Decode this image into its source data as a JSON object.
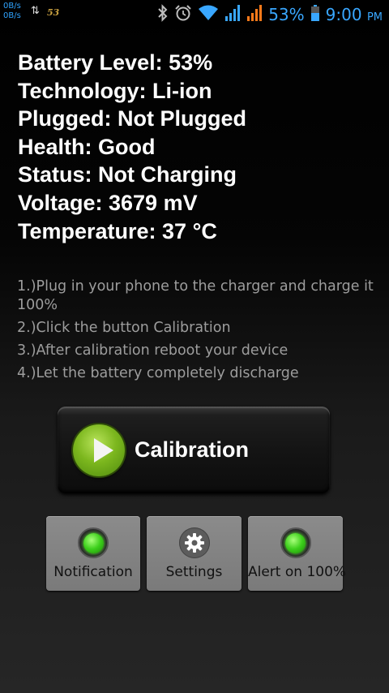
{
  "status_bar": {
    "net_up": "0B/s",
    "net_down": "0B/s",
    "notification_count": "53",
    "battery_percent": "53%",
    "time": "9:00",
    "ampm": "PM",
    "icons": [
      "bluetooth-icon",
      "alarm-icon",
      "wifi-icon",
      "signal-icon",
      "signal-2-icon",
      "battery-icon"
    ],
    "accent_color": "#39a7ff"
  },
  "battery_info": [
    "Battery Level: 53%",
    "Technology: Li-ion",
    "Plugged: Not Plugged",
    "Health: Good",
    "Status: Not Charging",
    "Voltage: 3679 mV",
    "Temperature: 37 °C"
  ],
  "instructions": [
    "1.)Plug in your phone to the charger and charge it 100%",
    "2.)Click the button Calibration",
    "3.)After calibration reboot your device",
    "4.)Let the battery completely discharge"
  ],
  "calibration_button": {
    "label": "Calibration",
    "icon": "play-icon"
  },
  "bottom_buttons": {
    "notification": {
      "label": "Notification",
      "icon": "green-led-icon",
      "state": "on"
    },
    "settings": {
      "label": "Settings",
      "icon": "gear-icon"
    },
    "alert": {
      "label": "Alert on 100%",
      "icon": "green-led-icon",
      "state": "on"
    }
  }
}
